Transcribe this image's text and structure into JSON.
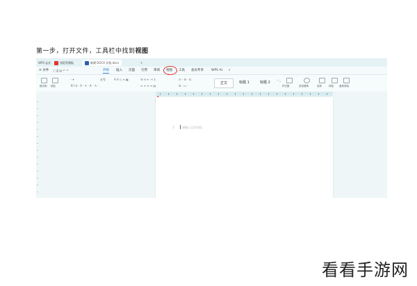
{
  "caption": {
    "prefix": "第一步，打开文件，工具栏中找到",
    "highlight": "视图"
  },
  "tabs": [
    {
      "label": "WPS 云文",
      "color": "#c9d3d6"
    },
    {
      "label": "找稻壳模板",
      "color": "#e0352b"
    },
    {
      "label": "新建 DOCX 文档.docx",
      "color": "#2a5fb0",
      "active": true
    },
    {
      "label": "+",
      "color": ""
    }
  ],
  "menu": {
    "file": "≡ 文件",
    "items": [
      "开始",
      "插入",
      "页面",
      "引用",
      "审阅",
      "视图",
      "工具",
      "会员专享"
    ],
    "active": "开始",
    "circled": "视图",
    "wps_ai": "WPS AI",
    "search_icon": "search-icon"
  },
  "ribbon": {
    "format_painter": "格式刷",
    "paste": "粘贴",
    "font_size": "五号",
    "styles": [
      "正文",
      "标题 1",
      "标题 2"
    ],
    "style_set": "样式集",
    "find_replace": "查找替换",
    "select": "选择",
    "layout": "排版",
    "reorganize": "重新排版"
  },
  "document": {
    "line_number": "1",
    "placeholder": "请输入正文内容..."
  },
  "watermark": "看看手游网",
  "colors": {
    "highlight_red": "#e0352b",
    "accent_blue": "#2a7fd4"
  }
}
